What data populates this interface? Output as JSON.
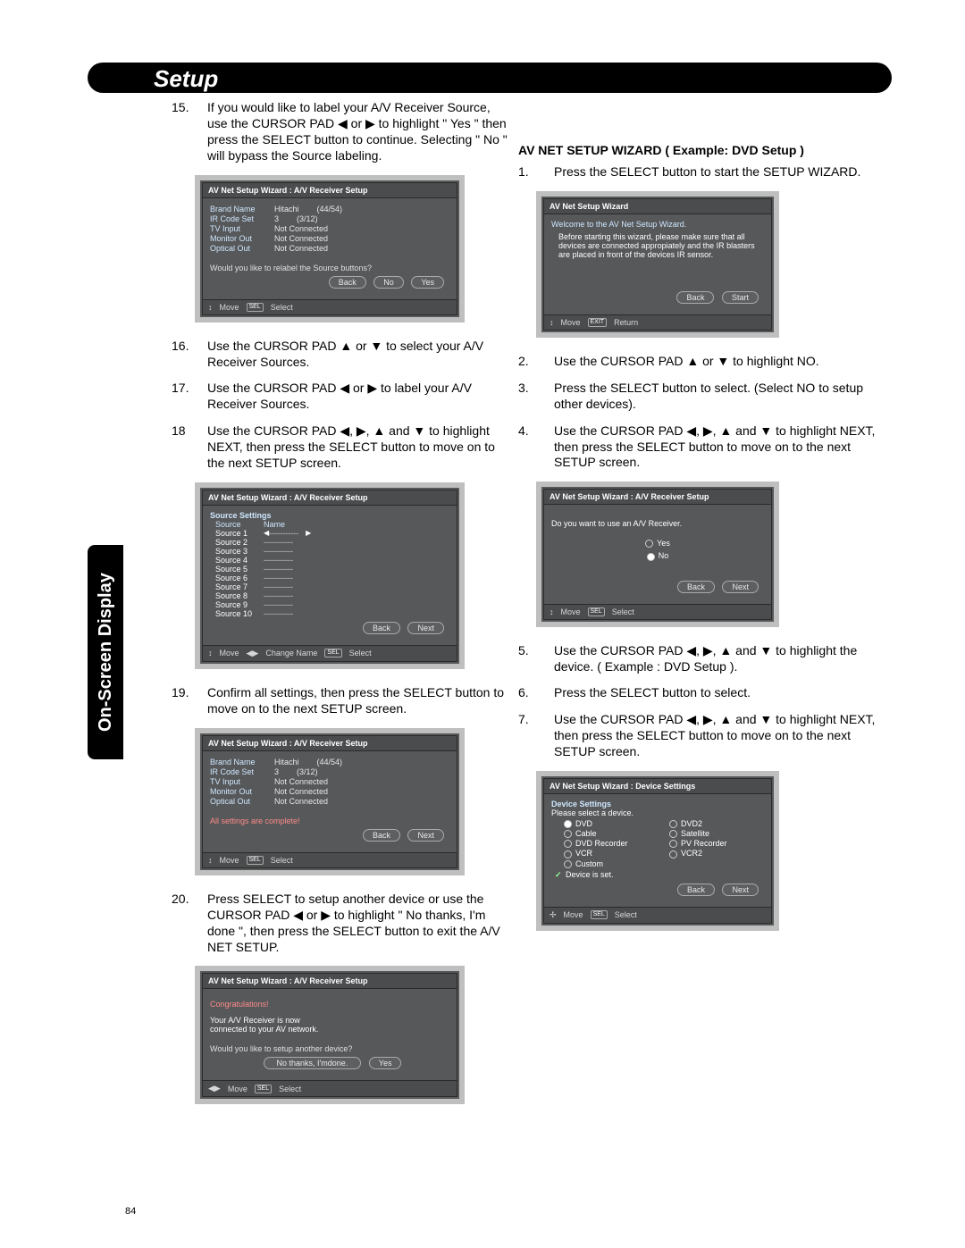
{
  "header": "Setup",
  "side_tab": "On-Screen Display",
  "page_number": "84",
  "left_steps": [
    {
      "n": "15.",
      "t": "If you would like to label your  A/V Receiver Source, use the CURSOR PAD ◀ or ▶ to highlight  \" Yes \" then press the SELECT button to continue. Selecting \" No \" will bypass the Source labeling."
    },
    {
      "n": "16.",
      "t": "Use the CURSOR PAD ▲ or ▼ to select your A/V Receiver Sources."
    },
    {
      "n": "17.",
      "t": "Use the CURSOR PAD ◀ or ▶ to label your A/V Receiver Sources."
    },
    {
      "n": "18",
      "t": "Use the CURSOR PAD ◀, ▶, ▲ and ▼ to highlight NEXT, then press the SELECT button to move on to the next SETUP screen."
    },
    {
      "n": "19.",
      "t": "Confirm all settings, then  press the SELECT button to move on to the next SETUP screen."
    },
    {
      "n": "20.",
      "t": "Press SELECT to setup another device or use the CURSOR PAD ◀ or ▶ to highlight \" No thanks, I'm done \", then press the SELECT button to exit the A/V NET SETUP."
    }
  ],
  "right_header": "AV NET SETUP WIZARD ( Example: DVD Setup )",
  "right_steps": [
    {
      "n": "1.",
      "t": "Press the SELECT button to start the SETUP WIZARD."
    },
    {
      "n": "2.",
      "t": "Use the CURSOR PAD ▲ or ▼ to highlight NO."
    },
    {
      "n": "3.",
      "t": "Press the SELECT button to select. (Select NO to setup other devices)."
    },
    {
      "n": "4.",
      "t": "Use the CURSOR PAD ◀, ▶, ▲ and ▼ to highlight NEXT, then press the SELECT button to move on to the next SETUP screen."
    },
    {
      "n": "5.",
      "t": "Use the CURSOR PAD  ◀, ▶, ▲ and ▼ to highlight the device. ( Example : DVD Setup )."
    },
    {
      "n": "6.",
      "t": "Press the SELECT button to select."
    },
    {
      "n": "7.",
      "t": "Use the CURSOR PAD ◀, ▶, ▲ and ▼ to highlight NEXT, then press the SELECT button to move on to the next SETUP screen."
    }
  ],
  "sc1": {
    "title": "AV Net Setup Wizard : A/V Receiver Setup",
    "rows": [
      [
        "Brand Name",
        "Hitachi",
        "(44/54)"
      ],
      [
        "IR Code Set",
        "3",
        "(3/12)"
      ],
      [
        "TV Input",
        "Not Connected",
        ""
      ],
      [
        "Monitor Out",
        "Not Connected",
        ""
      ],
      [
        "Optical Out",
        "Not Connected",
        ""
      ]
    ],
    "msg": "Would you like to relabel the Source buttons?",
    "buttons": [
      "Back",
      "No",
      "Yes"
    ],
    "footer": [
      "Move",
      "Select"
    ]
  },
  "sc2": {
    "title": "AV Net Setup Wizard : A/V Receiver Setup",
    "sub": "Source Settings",
    "cols": [
      "Source",
      "Name"
    ],
    "sources": [
      "Source 1",
      "Source 2",
      "Source 3",
      "Source 4",
      "Source 5",
      "Source 6",
      "Source 7",
      "Source 8",
      "Source 9",
      "Source 10"
    ],
    "dash": "-----------",
    "buttons": [
      "Back",
      "Next"
    ],
    "footer": [
      "Move",
      "Change Name",
      "Select"
    ]
  },
  "sc3": {
    "title": "AV Net Setup Wizard : A/V Receiver Setup",
    "rows": [
      [
        "Brand Name",
        "Hitachi",
        "(44/54)"
      ],
      [
        "IR Code Set",
        "3",
        "(3/12)"
      ],
      [
        "TV Input",
        "Not Connected",
        ""
      ],
      [
        "Monitor Out",
        "Not Connected",
        ""
      ],
      [
        "Optical Out",
        "Not Connected",
        ""
      ]
    ],
    "msg": "All settings are complete!",
    "buttons": [
      "Back",
      "Next"
    ],
    "footer": [
      "Move",
      "Select"
    ]
  },
  "sc4": {
    "title": "AV Net Setup Wizard : A/V Receiver Setup",
    "congrats": "Congratulations!",
    "line1": "Your A/V Receiver is now",
    "line2": "connected to your AV network.",
    "msg": "Would you like to setup another device?",
    "buttons": [
      "No thanks, I'mdone.",
      "Yes"
    ],
    "footer": [
      "Move",
      "Select"
    ]
  },
  "sc5": {
    "title": "AV Net Setup Wizard",
    "welcome": "Welcome to the AV Net Setup Wizard.",
    "info": "Before starting this wizard, please make sure that all devices are connected appropiately and the IR blasters are placed in front of the devices IR sensor.",
    "buttons": [
      "Back",
      "Start"
    ],
    "footer": [
      "Move",
      "Return"
    ]
  },
  "sc6": {
    "title": "AV Net Setup Wizard : A/V Receiver Setup",
    "q": "Do you want to use an A/V Receiver.",
    "opts": [
      "Yes",
      "No"
    ],
    "buttons": [
      "Back",
      "Next"
    ],
    "footer": [
      "Move",
      "Select"
    ]
  },
  "sc7": {
    "title": "AV Net Setup Wizard : Device Settings",
    "sub": "Device Settings",
    "prompt": "Please select a device.",
    "devices": [
      [
        "DVD",
        "DVD2"
      ],
      [
        "Cable",
        "Satellite"
      ],
      [
        "DVD Recorder",
        "PV Recorder"
      ],
      [
        "VCR",
        "VCR2"
      ],
      [
        "Custom",
        ""
      ]
    ],
    "isset": "Device is set.",
    "buttons": [
      "Back",
      "Next"
    ],
    "footer": [
      "Move",
      "Select"
    ]
  }
}
